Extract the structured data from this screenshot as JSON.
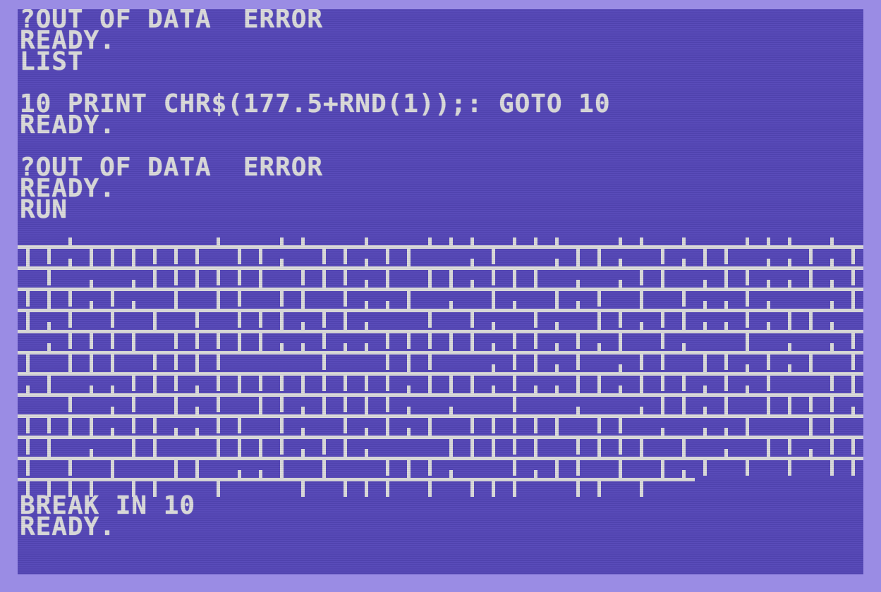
{
  "terminal": {
    "colors": {
      "background": "#5446b8",
      "border": "#9a8ce4",
      "text": "#dcdcdc"
    },
    "lines": [
      "?OUT OF DATA  ERROR",
      "READY.",
      "LIST",
      "",
      "10 PRINT CHR$(177.5+RND(1));: GOTO 10",
      "READY.",
      "",
      "?OUT OF DATA  ERROR",
      "READY.",
      "RUN"
    ],
    "after_output": [
      "BREAK IN 10",
      "READY."
    ]
  },
  "maze_output": {
    "glyphs": [
      "┴",
      "┬"
    ],
    "rows": 12,
    "columns": 40,
    "last_row_columns": 32
  }
}
